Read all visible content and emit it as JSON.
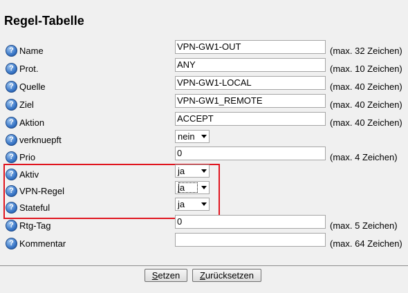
{
  "title": "Regel-Tabelle",
  "help_icon_glyph": "?",
  "rows": [
    {
      "label": "Name",
      "type": "text",
      "value": "VPN-GW1-OUT",
      "limit": "(max. 32 Zeichen)"
    },
    {
      "label": "Prot.",
      "type": "text",
      "value": "ANY",
      "limit": "(max. 10 Zeichen)"
    },
    {
      "label": "Quelle",
      "type": "text",
      "value": "VPN-GW1-LOCAL",
      "limit": "(max. 40 Zeichen)"
    },
    {
      "label": "Ziel",
      "type": "text",
      "value": "VPN-GW1_REMOTE",
      "limit": "(max. 40 Zeichen)"
    },
    {
      "label": "Aktion",
      "type": "text",
      "value": "ACCEPT",
      "limit": "(max. 40 Zeichen)"
    },
    {
      "label": "verknuepft",
      "type": "select",
      "value": "nein"
    },
    {
      "label": "Prio",
      "type": "text",
      "value": "0",
      "limit": "(max. 4 Zeichen)"
    },
    {
      "label": "Aktiv",
      "type": "select",
      "value": "ja"
    },
    {
      "label": "VPN-Regel",
      "type": "select",
      "value": "ja",
      "focused": true
    },
    {
      "label": "Stateful",
      "type": "select",
      "value": "ja"
    },
    {
      "label": "Rtg-Tag",
      "type": "text",
      "value": "0",
      "limit": "(max. 5 Zeichen)"
    },
    {
      "label": "Kommentar",
      "type": "text",
      "value": "",
      "limit": "(max. 64 Zeichen)"
    }
  ],
  "buttons": {
    "set": {
      "mnemonic": "S",
      "rest": "etzen"
    },
    "reset": {
      "mnemonic": "Z",
      "rest": "urücksetzen"
    }
  },
  "colors": {
    "highlight": "#e0141e",
    "background": "#f0f0f0"
  }
}
